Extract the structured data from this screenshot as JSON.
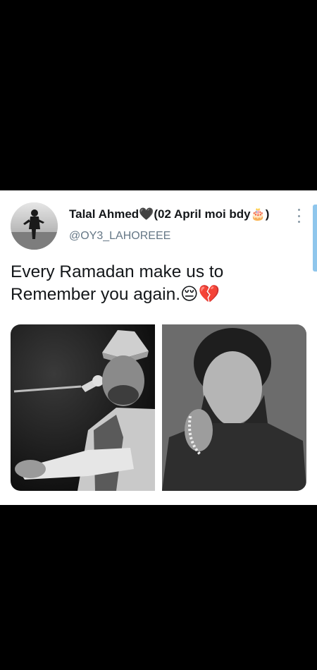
{
  "tweet": {
    "author_name": "Talal Ahmed🖤(02 April moi bdy🎂)",
    "author_handle": "@OY3_LAHOREEE",
    "text_line1": "Every Ramadan make us to",
    "text_line2": "Remember you again.😔💔",
    "media": [
      {
        "description": "black-and-white photo"
      },
      {
        "description": "black-and-white photo"
      }
    ]
  },
  "icons": {
    "more": "more-vertical-icon"
  },
  "colors": {
    "background": "#000000",
    "card": "#ffffff",
    "name": "#14171a",
    "handle": "#657786",
    "scroll_indicator": "#8fc6ec"
  }
}
